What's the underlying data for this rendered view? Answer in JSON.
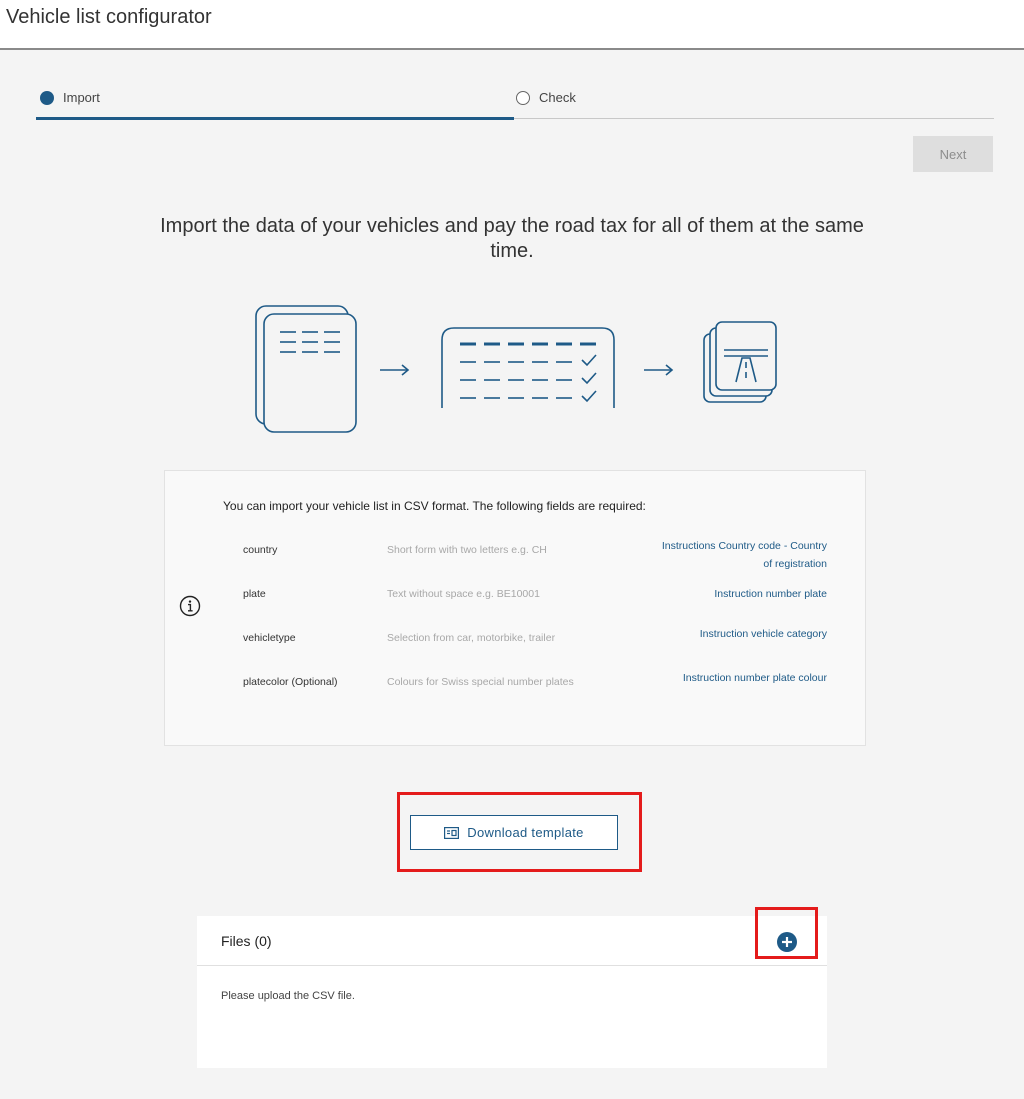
{
  "page": {
    "title": "Vehicle list configurator"
  },
  "stepper": {
    "steps": [
      {
        "label": "Import",
        "state": "active"
      },
      {
        "label": "Check",
        "state": "inactive"
      }
    ]
  },
  "actions": {
    "next_label": "Next"
  },
  "headline": "Import the data of your vehicles and pay the road tax for all of them at the same time.",
  "illustration": {
    "icons": [
      "document-stack-icon",
      "arrow-right-icon",
      "checklist-icon",
      "arrow-right-icon",
      "vignette-road-icon"
    ]
  },
  "info": {
    "icon": "info-icon",
    "intro": "You can import your vehicle list in CSV format. The following fields are required:",
    "fields": [
      {
        "name": "country",
        "description": "Short form with two letters e.g. CH",
        "link": "Instructions Country code - Country of registration"
      },
      {
        "name": "plate",
        "description": "Text without space e.g. BE10001",
        "link": "Instruction number plate"
      },
      {
        "name": "vehicletype",
        "description": "Selection from car, motorbike, trailer",
        "link": "Instruction vehicle category"
      },
      {
        "name": "platecolor (Optional)",
        "description": "Colours for Swiss special number plates",
        "link": "Instruction number plate colour"
      }
    ]
  },
  "download": {
    "label": "Download template",
    "icon": "template-icon"
  },
  "files": {
    "title": "Files (0)",
    "empty_text": "Please upload the CSV file.",
    "add_icon": "plus-circle-icon"
  },
  "colors": {
    "accent": "#1e5a87",
    "highlight": "#e41b1b",
    "disabled": "#dedede"
  }
}
